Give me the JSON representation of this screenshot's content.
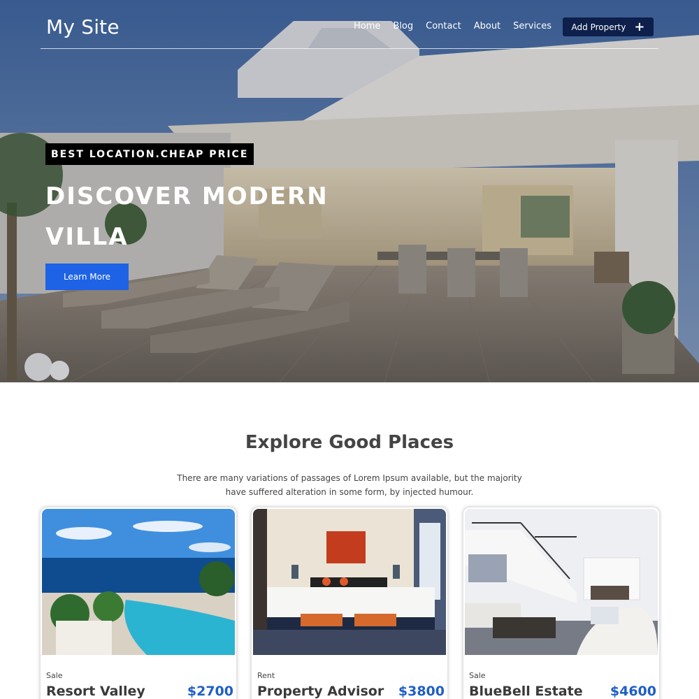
{
  "header": {
    "brand": "My Site",
    "nav": [
      "Home",
      "Blog",
      "Contact",
      "About",
      "Services"
    ],
    "add_property_label": "Add Property",
    "add_icon": "plus-icon"
  },
  "hero": {
    "tagline": "BEST LOCATION.CHEAP PRICE",
    "title": "DISCOVER MODERN VILLA",
    "cta_label": "Learn More"
  },
  "section": {
    "title": "Explore Good Places",
    "description": "There are many variations of passages of Lorem Ipsum available, but the majority have suffered alteration in some form, by injected humour."
  },
  "listings": [
    {
      "type": "Sale",
      "name": "Resort Valley",
      "price": "$2700"
    },
    {
      "type": "Rent",
      "name": "Property Advisor",
      "price": "$3800"
    },
    {
      "type": "Sale",
      "name": "BlueBell Estate",
      "price": "$4600"
    }
  ],
  "colors": {
    "accent": "#1e63e6",
    "nav_button": "#0d1f4a",
    "price": "#1f5fc6"
  }
}
